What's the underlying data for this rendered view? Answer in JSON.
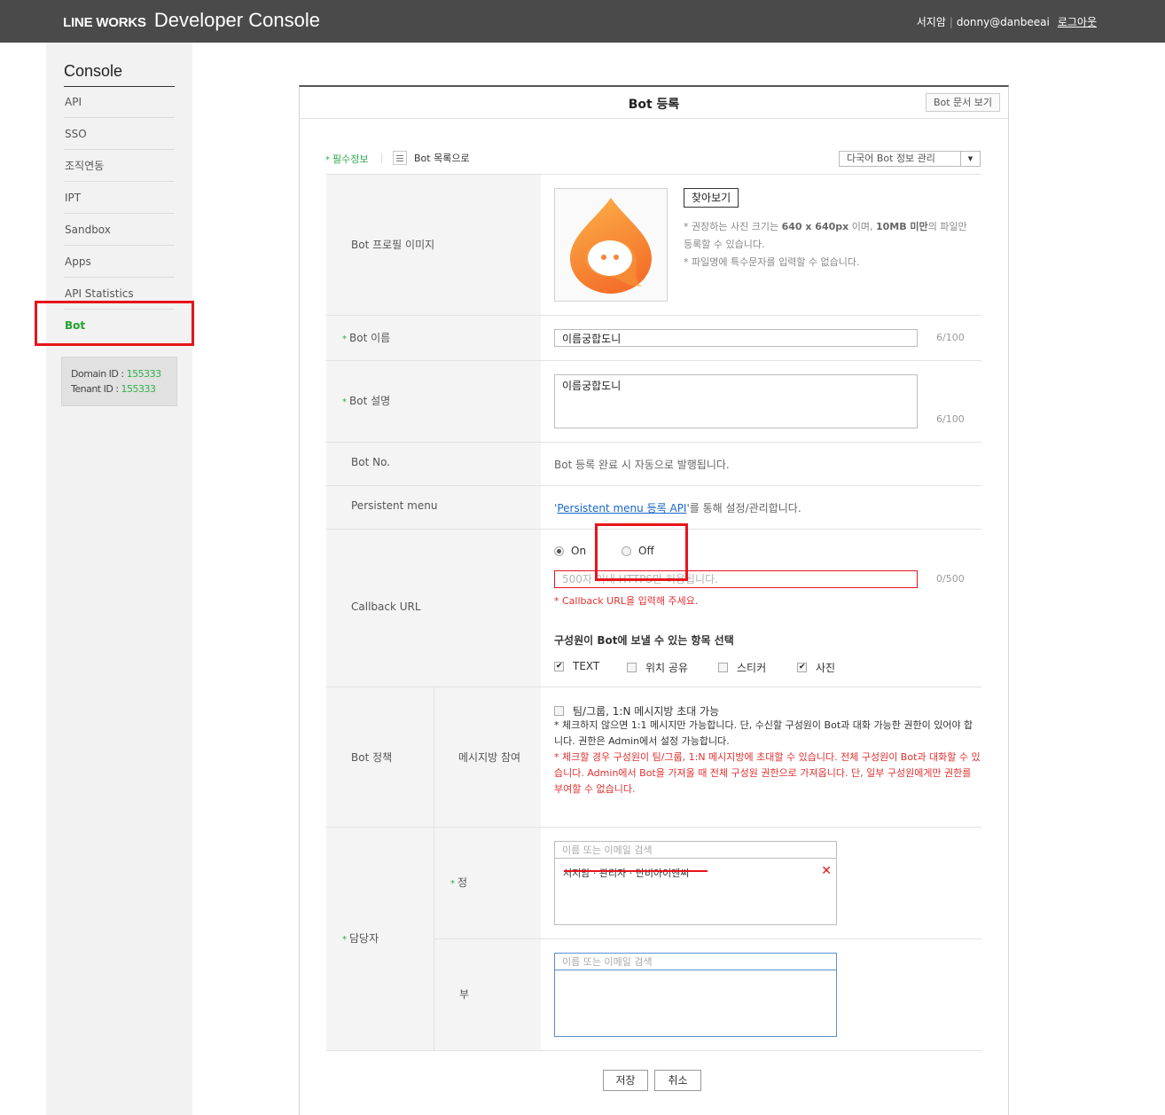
{
  "header": {
    "brand_bold": "LINE WORKS",
    "brand_light": "Developer Console",
    "user_name": "서지암",
    "user_email": "donny@danbeeai",
    "logout": "로그아웃"
  },
  "sidebar": {
    "title": "Console",
    "items": [
      {
        "label": "API"
      },
      {
        "label": "SSO"
      },
      {
        "label": "조직연동"
      },
      {
        "label": "IPT"
      },
      {
        "label": "Sandbox"
      },
      {
        "label": "Apps"
      },
      {
        "label": "API Statistics"
      },
      {
        "label": "Bot"
      }
    ],
    "active_item": "Bot",
    "domain_label": "Domain ID : ",
    "domain_id": "155333",
    "tenant_label": "Tenant ID : ",
    "tenant_id": "155333"
  },
  "panel": {
    "title": "Bot 등록",
    "doc_button": "Bot 문서 보기",
    "required_info": "필수정보",
    "list_link": "Bot 목록으로",
    "multilang_select": "다국어 Bot 정보 관리"
  },
  "form": {
    "profile_label": "Bot 프로필 이미지",
    "find_button": "찾아보기",
    "image_note_1a": "권장하는 사진 크기는 ",
    "image_note_1b": "640 x 640px",
    "image_note_1c": " 이며, ",
    "image_note_1d": "10MB 미만",
    "image_note_1e": "의 파일만",
    "image_note_2": "등록할 수 있습니다.",
    "image_note_3": "파일명에 특수문자를 입력할 수 없습니다.",
    "name_label": "Bot 이름",
    "name_value": "이름궁합도니",
    "name_count": "6/100",
    "desc_label": "Bot 설명",
    "desc_value": "이름궁합도니",
    "desc_count": "6/100",
    "no_label": "Bot No.",
    "no_value": "Bot 등록 완료 시 자동으로 발행됩니다.",
    "persistent_label": "Persistent menu",
    "persistent_prefix": "'",
    "persistent_link": "Persistent menu 등록 API",
    "persistent_suffix": "'를 통해 설정/관리합니다.",
    "callback_label": "Callback URL",
    "callback_on": "On",
    "callback_off": "Off",
    "callback_selected": "On",
    "callback_placeholder": "500자 이내 HTTPS만 허용됩니다.",
    "callback_count": "0/500",
    "callback_error": "Callback URL을 입력해 주세요.",
    "types_title": "구성원이 Bot에 보낼 수 있는 항목 선택",
    "types": [
      {
        "label": "TEXT",
        "checked": true
      },
      {
        "label": "위치 공유",
        "checked": false
      },
      {
        "label": "스티커",
        "checked": false
      },
      {
        "label": "사진",
        "checked": true
      }
    ],
    "policy_label": "Bot 정책",
    "room_label": "메시지방 참여",
    "room_checkbox": "팀/그룹, 1:N 메시지방 초대 가능",
    "room_checked": false,
    "room_note": "체크하지 않으면 1:1 메시지만 가능합니다. 단, 수신할 구성원이 Bot과 대화 가능한 권한이 있어야 합니다. 권한은 Admin에서 설정 가능합니다.",
    "room_warn": "체크할 경우 구성원이 팀/그룹, 1:N 메시지방에 초대할 수 있습니다. 전체 구성원이 Bot과 대화할 수 있습니다. Admin에서 Bot을 가져올 때 전체 구성원 권한으로 가져옵니다. 단, 일부 구성원에게만 권한를 부여할 수 없습니다.",
    "manager_label": "담당자",
    "primary_label": "정",
    "secondary_label": "부",
    "search_placeholder": "이름 또는 이메일 검색",
    "primary_chip": "서지암 · 관리자 · 단비아이엔씨",
    "save": "저장",
    "cancel": "취소"
  },
  "colors": {
    "accent_green": "#22a32e",
    "highlight_red": "#e8141b",
    "header_bg": "#4a4a4a"
  }
}
